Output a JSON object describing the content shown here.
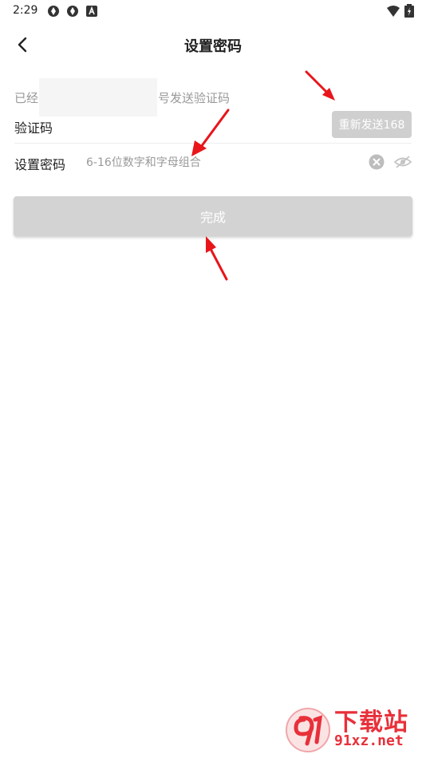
{
  "status_bar": {
    "time": "2:29",
    "icons": [
      "aperture-icon",
      "aperture-icon",
      "a-icon",
      "wifi-icon",
      "battery-icon"
    ]
  },
  "header": {
    "title": "设置密码",
    "back_icon": "chevron-left-icon"
  },
  "sent_notice": {
    "prefix": "已经",
    "suffix": "号发送验证码"
  },
  "verify_code": {
    "label": "验证码",
    "value": "",
    "resend_button": "重新发送168"
  },
  "password": {
    "label": "设置密码",
    "placeholder": "6-16位数字和字母组合",
    "clear_icon": "clear-circle-icon",
    "visibility_icon": "eye-icon"
  },
  "done_button": "完成",
  "watermark": {
    "name": "下载站",
    "url": "91xz.net",
    "badge_icon": "91-logo"
  },
  "colors": {
    "accent_disabled": "#d3d3d3",
    "arrow": "#e8151b",
    "watermark": "#e8303a",
    "muted_text": "#999999"
  }
}
